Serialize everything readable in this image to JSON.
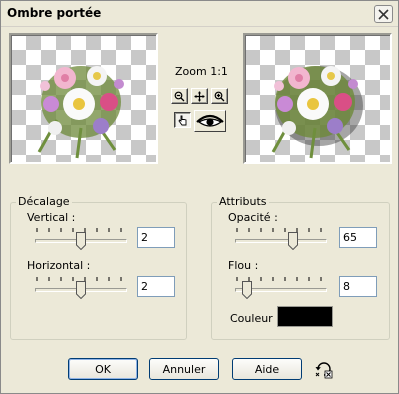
{
  "window": {
    "title": "Ombre portée",
    "close_icon": "close-icon"
  },
  "preview": {
    "zoom_label": "Zoom 1:1",
    "zoom_out_icon": "zoom-out-icon",
    "pan_icon": "pan-icon",
    "zoom_in_icon": "zoom-in-icon",
    "pointer_icon": "hand-pointer-icon",
    "eye_icon": "eye-icon"
  },
  "offset": {
    "group_title": "Décalage",
    "vertical_label": "Vertical :",
    "vertical_value": "2",
    "vertical_level": 0.5,
    "horizontal_label": "Horizontal :",
    "horizontal_value": "2",
    "horizontal_level": 0.5
  },
  "attributes": {
    "group_title": "Attributs",
    "opacity_label": "Opacité :",
    "opacity_value": "65",
    "opacity_level": 0.65,
    "blur_label": "Flou :",
    "blur_value": "8",
    "blur_level": 0.08,
    "color_label": "Couleur :",
    "color_value": "#000000"
  },
  "buttons": {
    "ok": "OK",
    "cancel": "Annuler",
    "help": "Aide",
    "reset_icon": "reset-icon"
  }
}
